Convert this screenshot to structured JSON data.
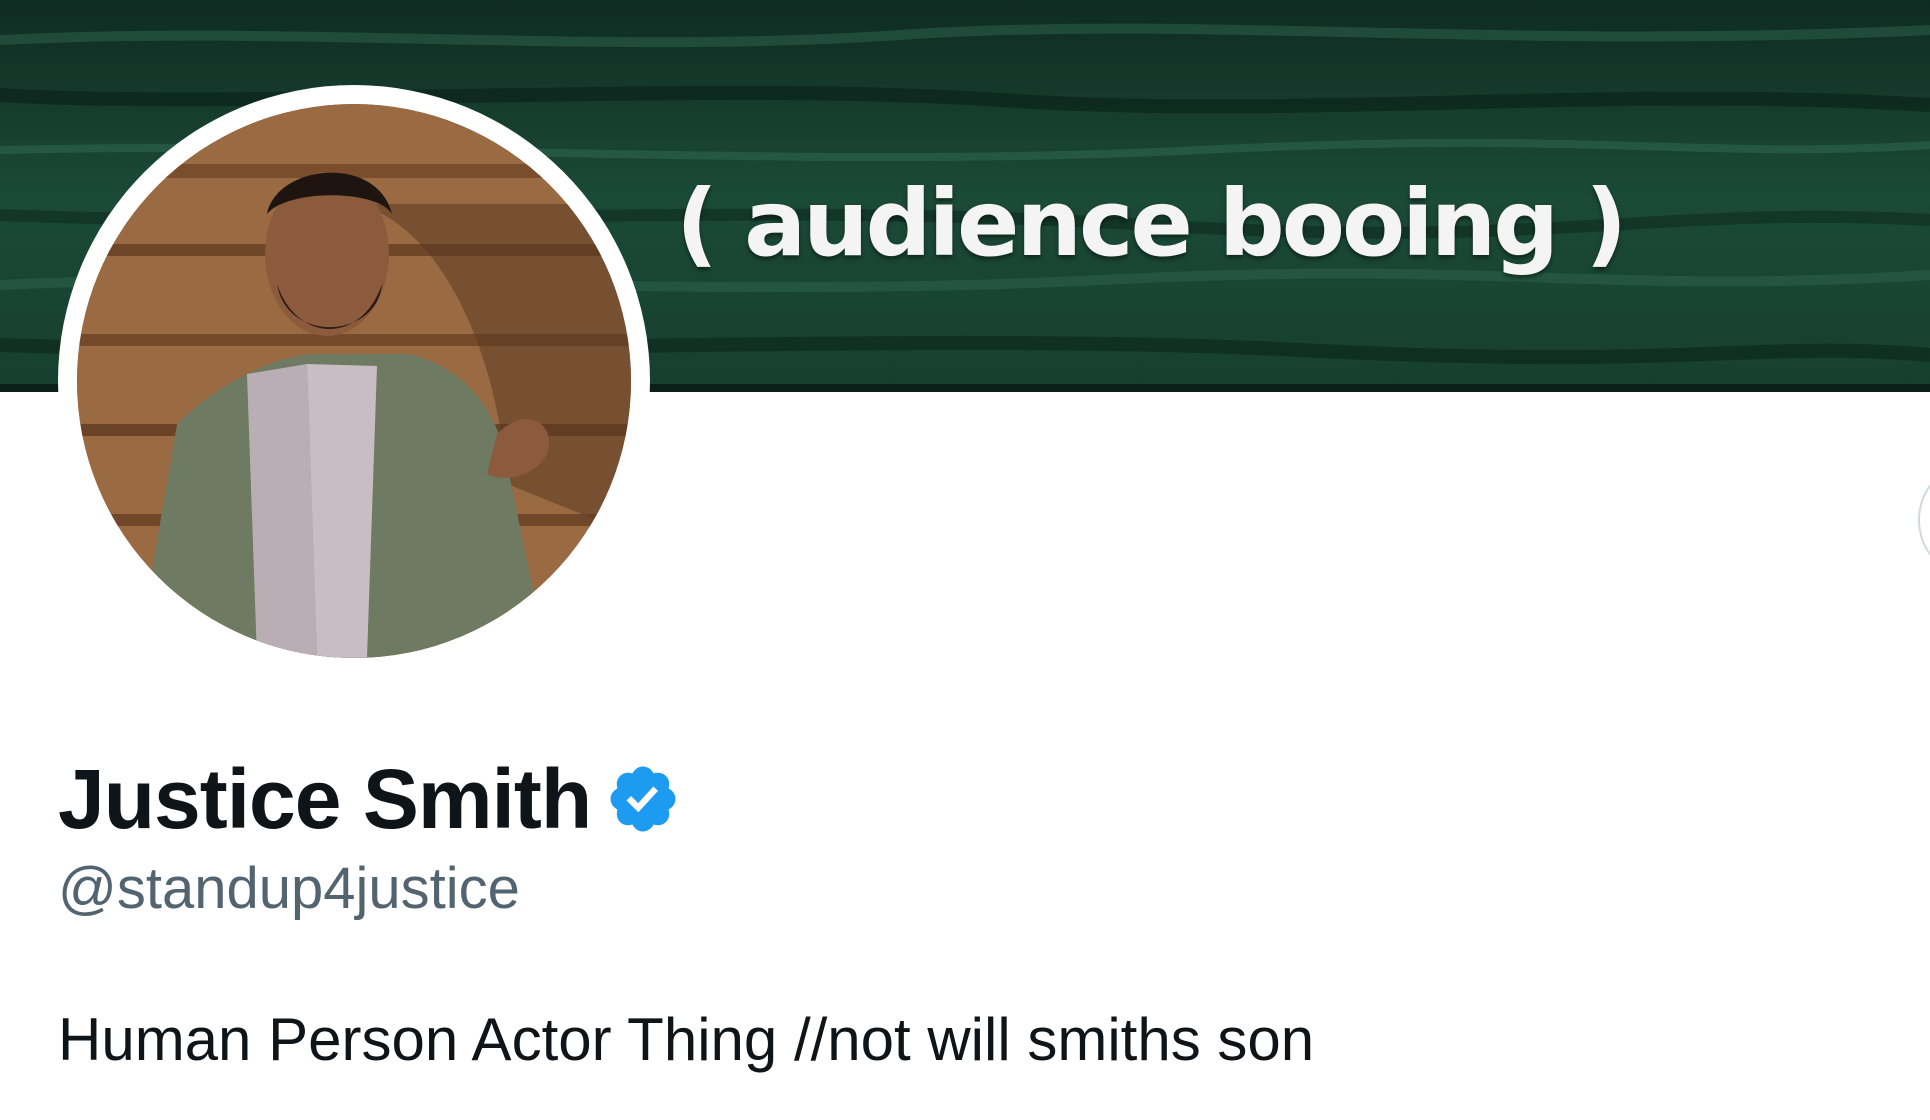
{
  "banner": {
    "text": "( audience booing )",
    "background_color": "#15402e"
  },
  "profile": {
    "display_name": "Justice Smith",
    "verified_icon": "verified-badge-icon",
    "verified_color": "#1d9bf0",
    "handle": "@standup4justice",
    "bio": "Human Person Actor Thing //not will smiths son"
  },
  "colors": {
    "name_text": "#0f1419",
    "handle_text": "#536471",
    "bio_text": "#0f1419"
  }
}
